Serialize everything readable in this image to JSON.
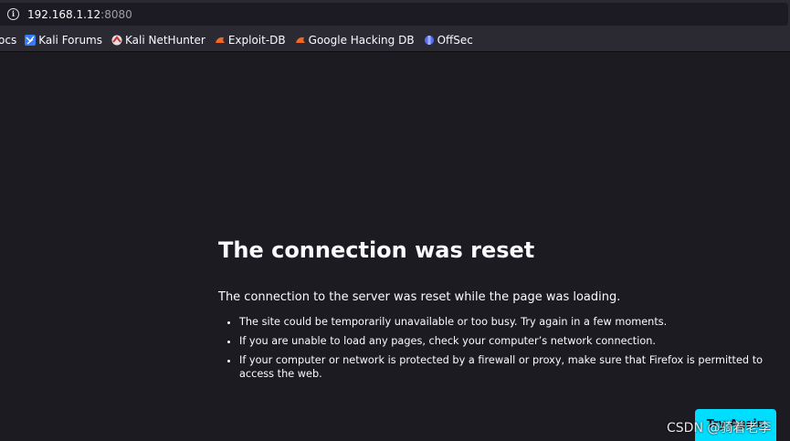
{
  "address_bar": {
    "host": "192.168.1.12",
    "port": ":8080"
  },
  "bookmarks": [
    {
      "label": "ocs",
      "icon": "partial-bookmark"
    },
    {
      "label": "Kali Forums",
      "icon": "kali-forums-icon"
    },
    {
      "label": "Kali NetHunter",
      "icon": "kali-nethunter-icon"
    },
    {
      "label": "Exploit-DB",
      "icon": "exploit-db-icon"
    },
    {
      "label": "Google Hacking DB",
      "icon": "ghdb-icon"
    },
    {
      "label": "OffSec",
      "icon": "offsec-icon"
    }
  ],
  "error": {
    "title": "The connection was reset",
    "description": "The connection to the server was reset while the page was loading.",
    "tips": [
      "The site could be temporarily unavailable or too busy. Try again in a few moments.",
      "If you are unable to load any pages, check your computer’s network connection.",
      "If your computer or network is protected by a firewall or proxy, make sure that Firefox is permitted to access the web."
    ],
    "button_label": "Try Again"
  },
  "watermark": "CSDN @骑着老李",
  "colors": {
    "page_bg": "#1c1b22",
    "toolbar_bg": "#2b2a33",
    "button_bg": "#00ddff"
  }
}
